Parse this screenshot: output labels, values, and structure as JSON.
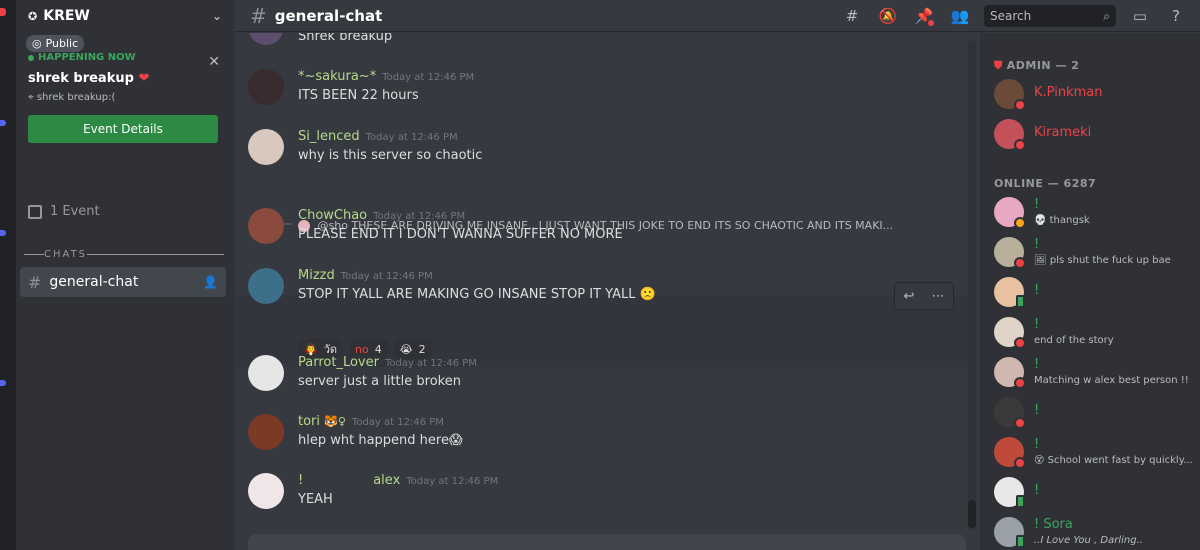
{
  "server": {
    "name": "KREW",
    "public_badge": "Public",
    "event_status": "HAPPENING NOW",
    "event_title": "shrek breakup",
    "event_location": "shrek breakup:(",
    "event_button": "Event Details",
    "events_count": "1 Event",
    "category": "CHATS",
    "channel": "general-chat"
  },
  "header": {
    "channel": "general-chat",
    "search_placeholder": "Search"
  },
  "messages": [
    {
      "author": "",
      "time": "",
      "text": "Shrek breakup",
      "color": "#dcddde"
    },
    {
      "author": "*~sakura~*",
      "time": "Today at 12:46 PM",
      "text": "ITS BEEN 22 hours",
      "color": "#b7d98b"
    },
    {
      "author": "Si_lenced",
      "time": "Today at 12:46 PM",
      "text": "why is this server so chaotic",
      "color": "#b7d98b"
    },
    {
      "author": "ChowChao",
      "time": "Today at 12:46 PM",
      "text": "PLEASE END IT I DON'T WANNA SUFFER NO MORE",
      "color": "#b7d98b",
      "reply_to": "@sho",
      "reply_text": "THESE ARE DRIVING ME INSANE,, I JUST WANT THIS JOKE TO END ITS SO CHAOTIC AND ITS MAKI..."
    },
    {
      "author": "Mizzd",
      "time": "Today at 12:46 PM",
      "text": "STOP IT YALL ARE MAKING GO INSANE STOP IT YALL",
      "color": "#b7d98b"
    },
    {
      "author": "Parrot_Lover",
      "time": "Today at 12:46 PM",
      "text": "server just a little broken",
      "color": "#b7d98b"
    },
    {
      "author": "tori",
      "time": "Today at 12:46 PM",
      "text": "hlep wht happend here",
      "color": "#b7d98b"
    },
    {
      "author": "!",
      "author2": "alex",
      "time": "Today at 12:46 PM",
      "text": "YEAH",
      "color": "#b7d98b"
    }
  ],
  "reactions": [
    {
      "emoji": "🧛",
      "count": "วัด"
    },
    {
      "emoji": "no",
      "count": "4"
    },
    {
      "emoji": "😭",
      "count": "2"
    }
  ],
  "members": {
    "admin_header": "ADMIN — 2",
    "admins": [
      "K.Pinkman",
      "Kirameki"
    ],
    "online_header": "ONLINE — 6287",
    "online": [
      {
        "name": "!",
        "status": "thangsk"
      },
      {
        "name": "!",
        "status": "pls shut the fuck up bae"
      },
      {
        "name": "!",
        "status": ""
      },
      {
        "name": "!",
        "status": "end of the story"
      },
      {
        "name": "!",
        "status": "Matching w alex best person !!"
      },
      {
        "name": "!",
        "status": ""
      },
      {
        "name": "!",
        "status": "School went fast by quickly..."
      },
      {
        "name": "!",
        "status": ""
      },
      {
        "name": "! Sora",
        "status": "..I Love You , Darling.."
      }
    ]
  }
}
